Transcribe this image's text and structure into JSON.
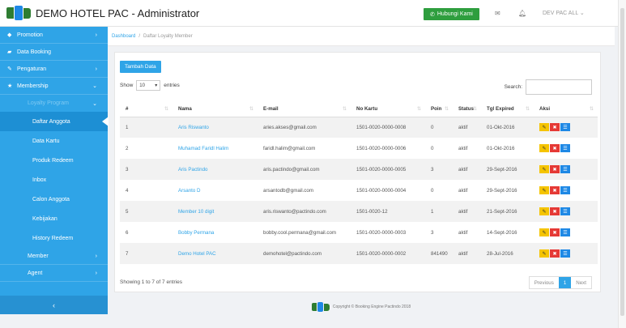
{
  "header": {
    "title": "DEMO HOTEL PAC - Administrator",
    "contact_button": "Hubungi Kami",
    "user": "DEV PAC ALL"
  },
  "sidebar": {
    "items": [
      {
        "label": "Promotion",
        "icon": "tag-icon",
        "has_arrow": true
      },
      {
        "label": "Data Booking",
        "icon": "book-icon",
        "has_arrow": false
      },
      {
        "label": "Pengaturan",
        "icon": "wrench-icon",
        "has_arrow": true
      },
      {
        "label": "Membership",
        "icon": "star-icon",
        "has_arrow": true
      }
    ],
    "loyalty": "Loyalty Program",
    "subitems": [
      "Daftar Anggota",
      "Data Kartu",
      "Produk Redeem",
      "Inbox",
      "Calon Anggota",
      "Kebijakan",
      "History Redeem"
    ],
    "bottom_items": [
      "Member",
      "Agent"
    ]
  },
  "breadcrumb": {
    "home": "Dashboard",
    "current": "Daftar Loyalty Member"
  },
  "panel": {
    "add_button": "Tambah Data",
    "show_label": "Show",
    "entries_value": "10",
    "entries_label": "entries",
    "search_label": "Search:",
    "columns": [
      "#",
      "Nama",
      "E-mail",
      "No Kartu",
      "Poin",
      "Status",
      "Tgl Expired",
      "Aksi"
    ],
    "rows": [
      {
        "no": "1",
        "nama": "Aris Riswanto",
        "email": "aries.akses@gmail.com",
        "kartu": "1501-0020-0000-0008",
        "poin": "0",
        "status": "aktif",
        "expired": "01-Okt-2016"
      },
      {
        "no": "2",
        "nama": "Muhamad Faridl Halim",
        "email": "faridl.halim@gmail.com",
        "kartu": "1501-0020-0000-0006",
        "poin": "0",
        "status": "aktif",
        "expired": "01-Okt-2016"
      },
      {
        "no": "3",
        "nama": "Aris Pactindo",
        "email": "aris.pactindo@gmail.com",
        "kartu": "1501-0020-0000-0005",
        "poin": "3",
        "status": "aktif",
        "expired": "29-Sept-2016"
      },
      {
        "no": "4",
        "nama": "Arsanto D",
        "email": "arsantodb@gmail.com",
        "kartu": "1501-0020-0000-0004",
        "poin": "0",
        "status": "aktif",
        "expired": "29-Sept-2016"
      },
      {
        "no": "5",
        "nama": "Member 10 digit",
        "email": "aris.riswanto@pactindo.com",
        "kartu": "1501-0020-12",
        "poin": "1",
        "status": "aktif",
        "expired": "21-Sept-2016"
      },
      {
        "no": "6",
        "nama": "Bobby Permana",
        "email": "bobby.cool.permana@gmail.com",
        "kartu": "1501-0020-0000-0003",
        "poin": "3",
        "status": "aktif",
        "expired": "14-Sept-2016"
      },
      {
        "no": "7",
        "nama": "Demo Hotel PAC",
        "email": "demohotel@pactindo.com",
        "kartu": "1501-0020-0000-0002",
        "poin": "841490",
        "status": "aktif",
        "expired": "28-Jul-2016"
      }
    ],
    "info": "Showing 1 to 7 of 7 entries",
    "pager": {
      "previous": "Previous",
      "current": "1",
      "next": "Next"
    }
  },
  "footer": {
    "text": "Copyright © Booking Engine Pactindo 2018"
  },
  "colors": {
    "accent": "#2fa4e7",
    "success": "#2e9e3e",
    "edit": "#f5c400",
    "delete": "#e53935"
  }
}
